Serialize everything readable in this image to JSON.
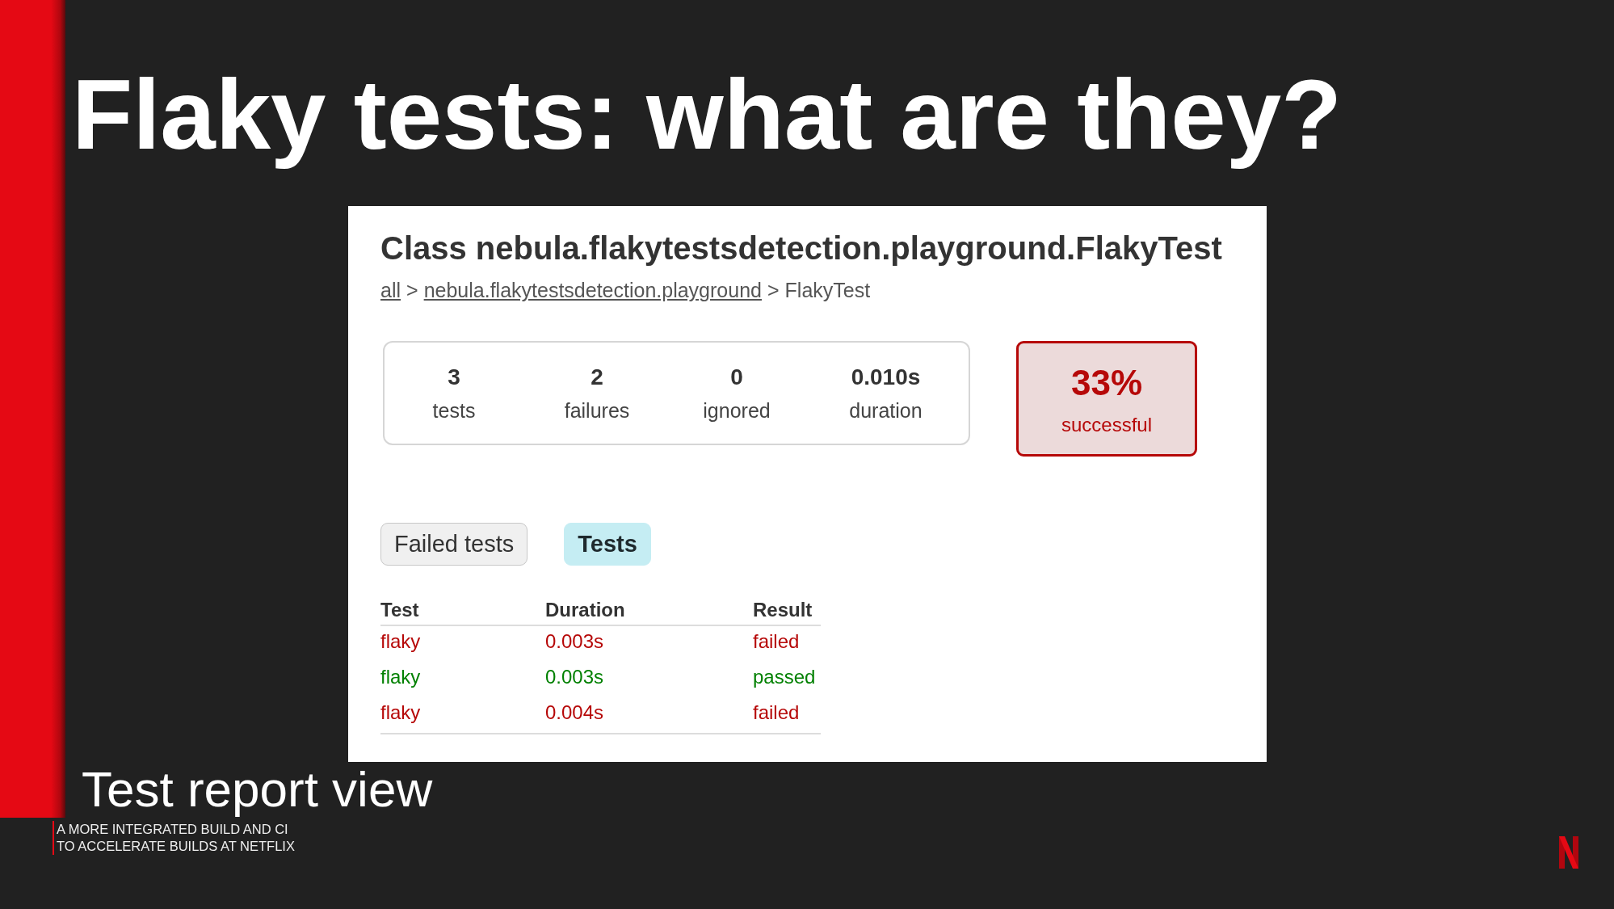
{
  "slide": {
    "title": "Flaky tests: what are they?",
    "report": {
      "heading": "Class nebula.flakytestsdetection.playground.FlakyTest",
      "breadcrumb": [
        {
          "kind": "link",
          "label": "all"
        },
        {
          "kind": "separator",
          "label": ">"
        },
        {
          "kind": "link",
          "label": "nebula.flakytestsdetection.playground"
        },
        {
          "kind": "separator",
          "label": ">"
        },
        {
          "kind": "current",
          "label": "FlakyTest"
        }
      ],
      "counters": [
        {
          "value": "3",
          "label": "tests"
        },
        {
          "value": "2",
          "label": "failures"
        },
        {
          "value": "0",
          "label": "ignored"
        },
        {
          "value": "0.010s",
          "label": "duration"
        }
      ],
      "success_rate": {
        "value": "33%",
        "label": "successful",
        "failed": true
      },
      "tabs": [
        {
          "label": "Failed tests",
          "selected": false
        },
        {
          "label": "Tests",
          "selected": true
        }
      ],
      "table": {
        "columns": [
          "Test",
          "Duration",
          "Result"
        ],
        "rows": [
          {
            "cells": [
              "flaky",
              "0.003s",
              "failed"
            ],
            "failed": true
          },
          {
            "cells": [
              "flaky",
              "0.003s",
              "passed"
            ],
            "failed": false
          },
          {
            "cells": [
              "flaky",
              "0.004s",
              "failed"
            ],
            "failed": true
          }
        ]
      }
    },
    "section_title": "Test report view",
    "talk_title": {
      "lines": [
        "A MORE INTEGRATED BUILD AND CI",
        "TO ACCELERATE BUILDS AT NETFLIX"
      ]
    }
  }
}
